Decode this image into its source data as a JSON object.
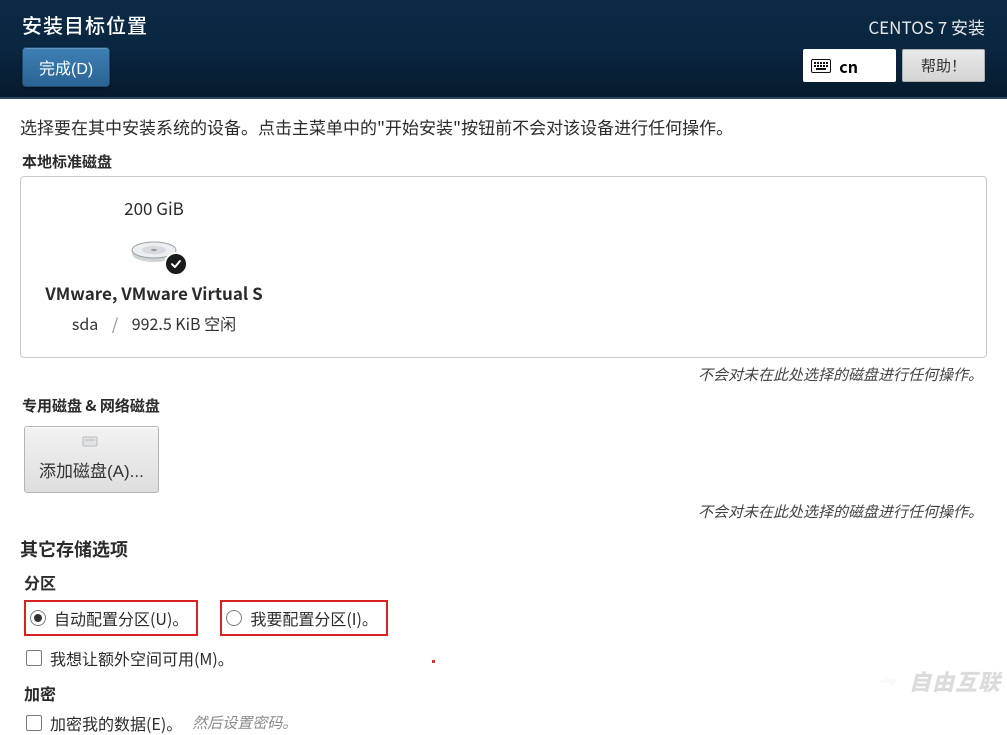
{
  "header": {
    "title": "安装目标位置",
    "done": "完成(D)",
    "install_label": "CENTOS 7 安装",
    "lang_code": "cn",
    "help": "帮助！"
  },
  "intro": "选择要在其中安装系统的设备。点击主菜单中的\"开始安装\"按钮前不会对该设备进行任何操作。",
  "local": {
    "label": "本地标准磁盘",
    "disk": {
      "size": "200 GiB",
      "name": "VMware, VMware Virtual S",
      "dev": "sda",
      "free": "992.5 KiB 空闲"
    },
    "hint": "不会对未在此处选择的磁盘进行任何操作。"
  },
  "special": {
    "label": "专用磁盘 & 网络磁盘",
    "add_disk": "添加磁盘(A)...",
    "hint": "不会对未在此处选择的磁盘进行任何操作。"
  },
  "other": {
    "title": "其它存储选项",
    "partition_label": "分区",
    "auto": "自动配置分区(U)。",
    "manual": "我要配置分区(I)。",
    "extra_space": "我想让额外空间可用(M)。",
    "encrypt_label": "加密",
    "encrypt_opt": "加密我的数据(E)。",
    "encrypt_hint": "然后设置密码。"
  },
  "watermark": "自由互联"
}
